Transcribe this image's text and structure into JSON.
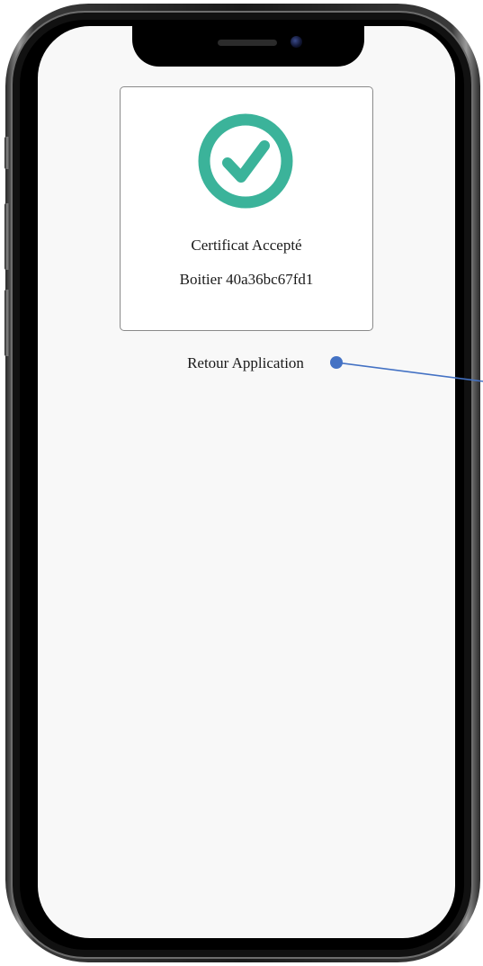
{
  "card": {
    "status_title": "Certificat Accepté",
    "device_label": "Boitier 40a36bc67fd1",
    "icon": "check-circle-icon",
    "icon_color": "#3bb39a"
  },
  "actions": {
    "return_label": "Retour Application"
  },
  "annotation": {
    "marker_color": "#4472c4"
  }
}
